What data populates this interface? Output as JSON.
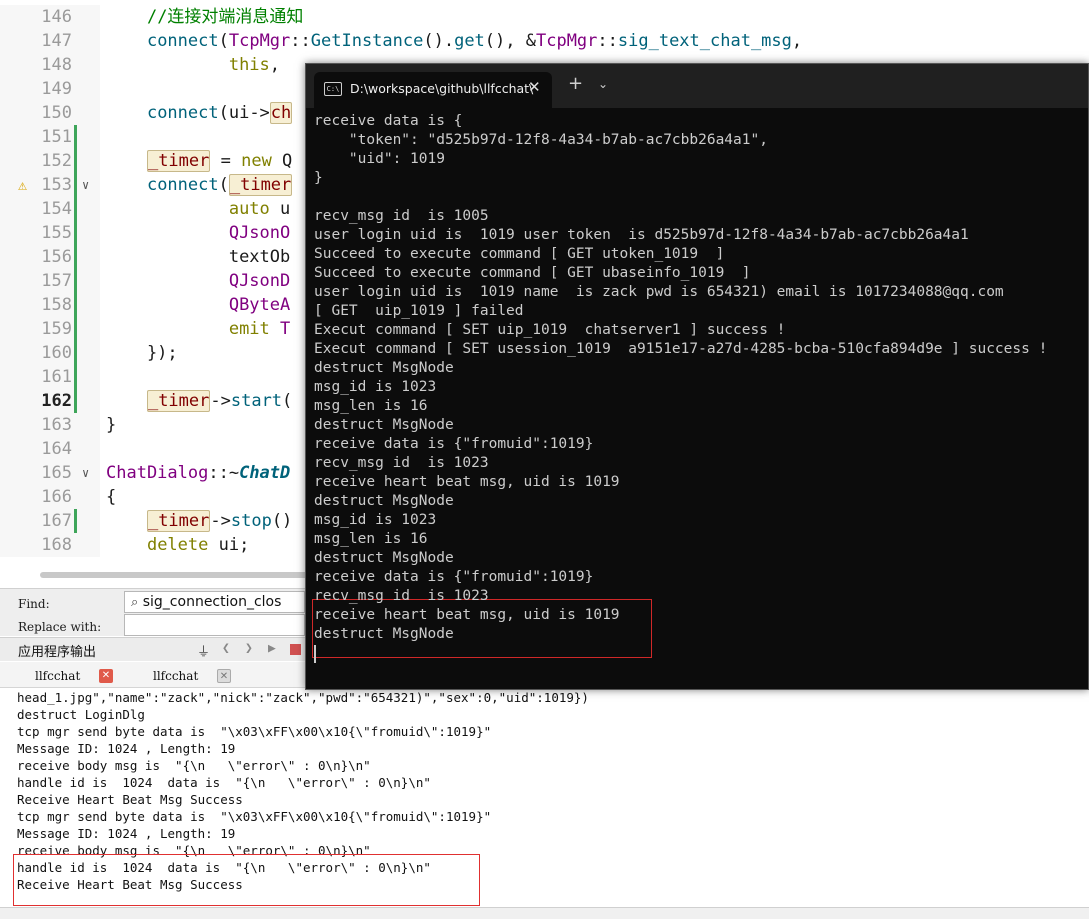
{
  "editor": {
    "lines": [
      {
        "num": "146",
        "segments": [
          {
            "t": "    ",
            "c": "plain"
          },
          {
            "t": "//连接对端消息通知",
            "c": "comment"
          }
        ]
      },
      {
        "num": "147",
        "segments": [
          {
            "t": "    ",
            "c": "plain"
          },
          {
            "t": "connect",
            "c": "func"
          },
          {
            "t": "(",
            "c": "plain"
          },
          {
            "t": "TcpMgr",
            "c": "type"
          },
          {
            "t": "::",
            "c": "plain"
          },
          {
            "t": "GetInstance",
            "c": "func"
          },
          {
            "t": "().",
            "c": "plain"
          },
          {
            "t": "get",
            "c": "func"
          },
          {
            "t": "(), &",
            "c": "plain"
          },
          {
            "t": "TcpMgr",
            "c": "type"
          },
          {
            "t": "::",
            "c": "plain"
          },
          {
            "t": "sig_text_chat_msg",
            "c": "func"
          },
          {
            "t": ",",
            "c": "plain"
          }
        ]
      },
      {
        "num": "148",
        "segments": [
          {
            "t": "            ",
            "c": "plain"
          },
          {
            "t": "this",
            "c": "kw"
          },
          {
            "t": ",",
            "c": "plain"
          }
        ]
      },
      {
        "num": "149",
        "segments": []
      },
      {
        "num": "150",
        "segments": [
          {
            "t": "    ",
            "c": "plain"
          },
          {
            "t": "connect",
            "c": "func"
          },
          {
            "t": "(ui->",
            "c": "plain"
          },
          {
            "t": "ch",
            "c": "member"
          }
        ]
      },
      {
        "num": "151",
        "segments": [],
        "changed": true
      },
      {
        "num": "152",
        "segments": [
          {
            "t": "    ",
            "c": "plain"
          },
          {
            "t": "_timer",
            "c": "member"
          },
          {
            "t": " = ",
            "c": "plain"
          },
          {
            "t": "new",
            "c": "kw"
          },
          {
            "t": " Q",
            "c": "plain"
          }
        ],
        "changed": true
      },
      {
        "num": "153",
        "segments": [
          {
            "t": "    ",
            "c": "plain"
          },
          {
            "t": "connect",
            "c": "func"
          },
          {
            "t": "(",
            "c": "plain"
          },
          {
            "t": "_timer",
            "c": "member"
          }
        ],
        "changed": true,
        "warning": true,
        "fold": true
      },
      {
        "num": "154",
        "segments": [
          {
            "t": "            ",
            "c": "plain"
          },
          {
            "t": "auto",
            "c": "kw"
          },
          {
            "t": " u",
            "c": "plain"
          }
        ],
        "changed": true
      },
      {
        "num": "155",
        "segments": [
          {
            "t": "            ",
            "c": "plain"
          },
          {
            "t": "QJsonO",
            "c": "type"
          }
        ],
        "changed": true
      },
      {
        "num": "156",
        "segments": [
          {
            "t": "            ",
            "c": "plain"
          },
          {
            "t": "textOb",
            "c": "plain"
          }
        ],
        "changed": true
      },
      {
        "num": "157",
        "segments": [
          {
            "t": "            ",
            "c": "plain"
          },
          {
            "t": "QJsonD",
            "c": "type"
          }
        ],
        "changed": true
      },
      {
        "num": "158",
        "segments": [
          {
            "t": "            ",
            "c": "plain"
          },
          {
            "t": "QByteA",
            "c": "type"
          }
        ],
        "changed": true
      },
      {
        "num": "159",
        "segments": [
          {
            "t": "            ",
            "c": "plain"
          },
          {
            "t": "emit",
            "c": "kw"
          },
          {
            "t": " T",
            "c": "type"
          }
        ],
        "changed": true
      },
      {
        "num": "160",
        "segments": [
          {
            "t": "    });",
            "c": "plain"
          }
        ],
        "changed": true
      },
      {
        "num": "161",
        "segments": [],
        "changed": true
      },
      {
        "num": "162",
        "segments": [
          {
            "t": "    ",
            "c": "plain"
          },
          {
            "t": "_timer",
            "c": "member"
          },
          {
            "t": "->",
            "c": "plain"
          },
          {
            "t": "start",
            "c": "func"
          },
          {
            "t": "(",
            "c": "plain"
          }
        ],
        "changed": true,
        "current": true
      },
      {
        "num": "163",
        "segments": [
          {
            "t": "}",
            "c": "plain"
          }
        ]
      },
      {
        "num": "164",
        "segments": []
      },
      {
        "num": "165",
        "segments": [
          {
            "t": "ChatDialog",
            "c": "type"
          },
          {
            "t": "::~",
            "c": "plain"
          },
          {
            "t": "ChatD",
            "c": "italic"
          }
        ],
        "fold": true
      },
      {
        "num": "166",
        "segments": [
          {
            "t": "{",
            "c": "plain"
          }
        ]
      },
      {
        "num": "167",
        "segments": [
          {
            "t": "    ",
            "c": "plain"
          },
          {
            "t": "_timer",
            "c": "member"
          },
          {
            "t": "->",
            "c": "plain"
          },
          {
            "t": "stop",
            "c": "func"
          },
          {
            "t": "()",
            "c": "plain"
          }
        ],
        "changed": true
      },
      {
        "num": "168",
        "segments": [
          {
            "t": "    ",
            "c": "plain"
          },
          {
            "t": "delete",
            "c": "kw"
          },
          {
            "t": " ui;",
            "c": "plain"
          }
        ]
      }
    ],
    "colors": {
      "comment": "#008000",
      "func": "#00627a",
      "type": "#800080",
      "kw": "#808000",
      "member": "#800000"
    }
  },
  "findbar": {
    "find_label": "Find:",
    "replace_label": "Replace with:",
    "find_value": "sig_connection_clos",
    "search_icon": "search-icon"
  },
  "output": {
    "title": "应用程序输出",
    "tabs": [
      {
        "label": "llfcchat",
        "active": true
      },
      {
        "label": "llfcchat",
        "active": false
      }
    ],
    "lines": [
      "head_1.jpg\",\"name\":\"zack\",\"nick\":\"zack\",\"pwd\":\"654321)\",\"sex\":0,\"uid\":1019})",
      "destruct LoginDlg",
      "tcp mgr send byte data is  \"\\x03\\xFF\\x00\\x10{\\\"fromuid\\\":1019}\"",
      "Message ID: 1024 , Length: 19",
      "receive body msg is  \"{\\n   \\\"error\\\" : 0\\n}\\n\"",
      "handle id is  1024  data is  \"{\\n   \\\"error\\\" : 0\\n}\\n\"",
      "Receive Heart Beat Msg Success",
      "tcp mgr send byte data is  \"\\x03\\xFF\\x00\\x10{\\\"fromuid\\\":1019}\"",
      "Message ID: 1024 , Length: 19",
      "receive body msg is  \"{\\n   \\\"error\\\" : 0\\n}\\n\"",
      "handle id is  1024  data is  \"{\\n   \\\"error\\\" : 0\\n}\\n\"",
      "Receive Heart Beat Msg Success"
    ]
  },
  "terminal": {
    "tab_title": "D:\\workspace\\github\\llfcchat\\",
    "tab_close": "✕",
    "new_tab": "+",
    "dropdown": "⌄",
    "lines": [
      "receive data is {",
      "    \"token\": \"d525b97d-12f8-4a34-b7ab-ac7cbb26a4a1\",",
      "    \"uid\": 1019",
      "}",
      "",
      "recv_msg id  is 1005",
      "user login uid is  1019 user token  is d525b97d-12f8-4a34-b7ab-ac7cbb26a4a1",
      "Succeed to execute command [ GET utoken_1019  ]",
      "Succeed to execute command [ GET ubaseinfo_1019  ]",
      "user login uid is  1019 name  is zack pwd is 654321) email is 1017234088@qq.com",
      "[ GET  uip_1019 ] failed",
      "Execut command [ SET uip_1019  chatserver1 ] success !",
      "Execut command [ SET usession_1019  a9151e17-a27d-4285-bcba-510cfa894d9e ] success !",
      "destruct MsgNode",
      "msg_id is 1023",
      "msg_len is 16",
      "destruct MsgNode",
      "receive data is {\"fromuid\":1019}",
      "recv_msg id  is 1023",
      "receive heart beat msg, uid is 1019",
      "destruct MsgNode",
      "msg_id is 1023",
      "msg_len is 16",
      "destruct MsgNode",
      "receive data is {\"fromuid\":1019}",
      "recv_msg id  is 1023",
      "receive heart beat msg, uid is 1019",
      "destruct MsgNode"
    ]
  }
}
